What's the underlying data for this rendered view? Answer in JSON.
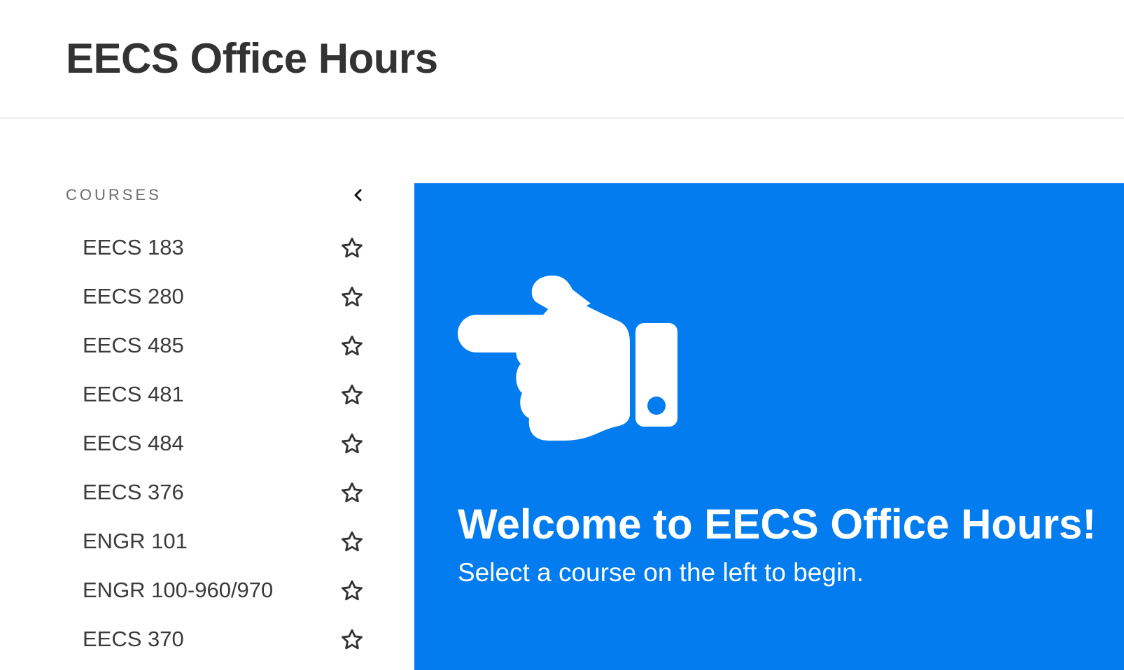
{
  "header": {
    "title": "EECS Office Hours"
  },
  "sidebar": {
    "section_label": "COURSES",
    "collapse_icon": "chevron-left-icon",
    "favorite_icon": "star-outline-icon",
    "courses": [
      {
        "label": "EECS 183"
      },
      {
        "label": "EECS 280"
      },
      {
        "label": "EECS 485"
      },
      {
        "label": "EECS 481"
      },
      {
        "label": "EECS 484"
      },
      {
        "label": "EECS 376"
      },
      {
        "label": "ENGR 101"
      },
      {
        "label": "ENGR 100-960/970"
      },
      {
        "label": "EECS 370"
      }
    ]
  },
  "welcome": {
    "icon": "hand-pointing-left-icon",
    "title": "Welcome to EECS Office Hours!",
    "subtitle": "Select a course on the left to begin."
  },
  "colors": {
    "accent": "#027cee",
    "text": "#333333",
    "muted": "#6b6b6b",
    "divider": "#f2f2f2"
  }
}
